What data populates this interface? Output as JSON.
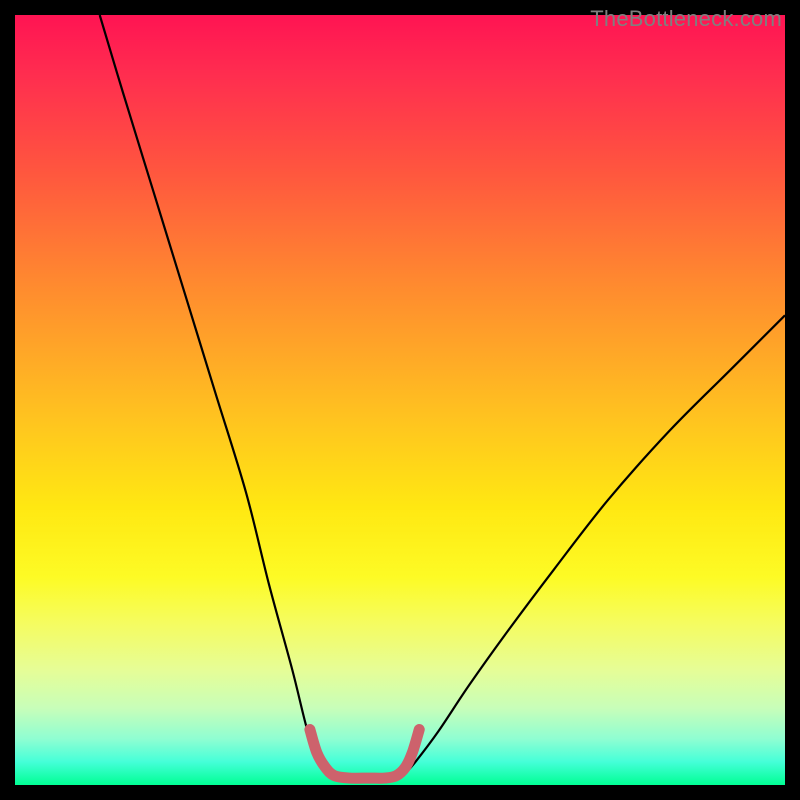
{
  "watermark": "TheBottleneck.com",
  "chart_data": {
    "type": "line",
    "title": "",
    "xlabel": "",
    "ylabel": "",
    "xlim": [
      0,
      100
    ],
    "ylim": [
      0,
      100
    ],
    "series": [
      {
        "name": "left-curve-black",
        "stroke": "#000000",
        "stroke_width": 2.2,
        "x": [
          11,
          14,
          18,
          22,
          26,
          30,
          33,
          36,
          38,
          39.5,
          40.6
        ],
        "y": [
          100,
          90,
          77,
          64,
          51,
          38,
          26,
          15,
          7,
          3,
          1.2
        ]
      },
      {
        "name": "right-curve-black",
        "stroke": "#000000",
        "stroke_width": 2.2,
        "x": [
          50.4,
          52,
          55,
          59,
          64,
          70,
          77,
          85,
          93,
          100
        ],
        "y": [
          1.2,
          3,
          7,
          13,
          20,
          28,
          37,
          46,
          54,
          61
        ]
      },
      {
        "name": "bottom-highlight-pink",
        "stroke": "#cd626c",
        "stroke_width": 11,
        "linecap": "round",
        "x": [
          38.3,
          39.2,
          40.3,
          41.5,
          43.5,
          46,
          48,
          49.5,
          50.7,
          51.6,
          52.5
        ],
        "y": [
          7.2,
          4.2,
          2.3,
          1.2,
          0.9,
          0.9,
          0.9,
          1.2,
          2.3,
          4.2,
          7.2
        ]
      }
    ]
  }
}
